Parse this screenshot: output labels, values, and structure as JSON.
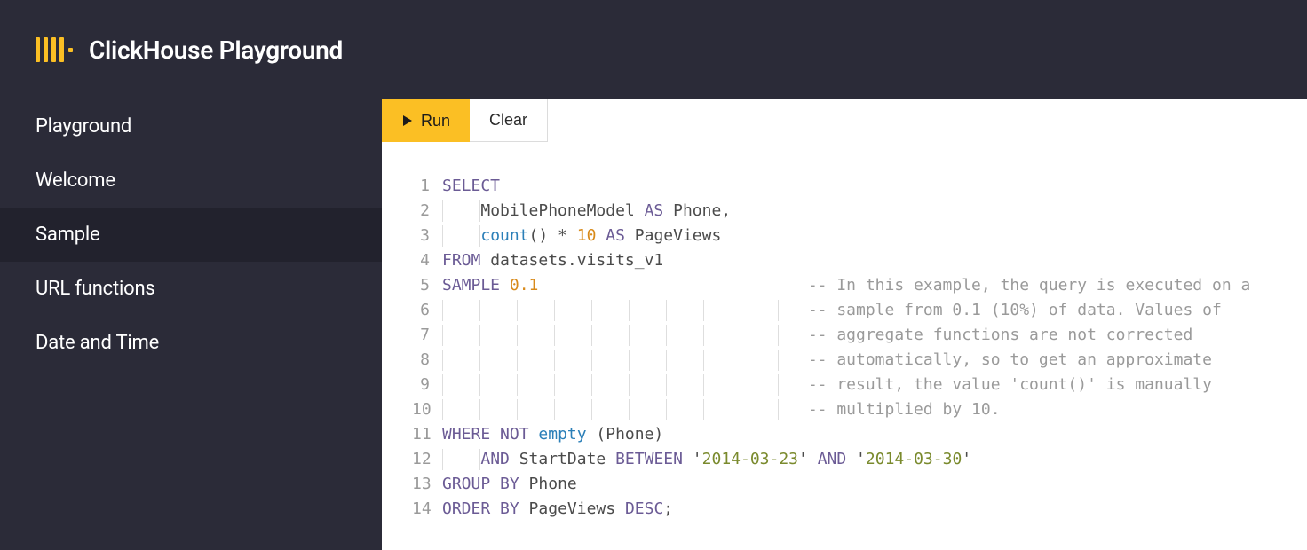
{
  "header": {
    "title": "ClickHouse Playground"
  },
  "sidebar": {
    "items": [
      {
        "label": "Playground",
        "active": false
      },
      {
        "label": "Welcome",
        "active": false
      },
      {
        "label": "Sample",
        "active": true
      },
      {
        "label": "URL functions",
        "active": false
      },
      {
        "label": "Date and Time",
        "active": false
      }
    ]
  },
  "toolbar": {
    "run": "Run",
    "clear": "Clear"
  },
  "editor": {
    "lines": [
      {
        "n": 1,
        "html": "<span class='kw'>SELECT</span>"
      },
      {
        "n": 2,
        "html": "<span class='guides short'>    </span><span class='ident'>MobilePhoneModel </span><span class='kw'>AS</span><span class='ident'> Phone,</span>"
      },
      {
        "n": 3,
        "html": "<span class='guides short'>    </span><span class='fn'>count</span><span class='ident'>() * </span><span class='num'>10</span><span class='ident'> </span><span class='kw'>AS</span><span class='ident'> PageViews</span>"
      },
      {
        "n": 4,
        "html": "<span class='kw'>FROM</span><span class='ident'> datasets.visits_v1</span>"
      },
      {
        "n": 5,
        "html": "<span class='kw'>SAMPLE</span><span class='ident'> </span><span class='num'>0.1</span><span class='ident'>                            </span><span class='cmt'>-- In this example, the query is executed on a</span>"
      },
      {
        "n": 6,
        "html": "<span class='guides'>                                      </span><span class='cmt'>-- sample from 0.1 (10%) of data. Values of</span>"
      },
      {
        "n": 7,
        "html": "<span class='guides'>                                      </span><span class='cmt'>-- aggregate functions are not corrected</span>"
      },
      {
        "n": 8,
        "html": "<span class='guides'>                                      </span><span class='cmt'>-- automatically, so to get an approximate</span>"
      },
      {
        "n": 9,
        "html": "<span class='guides'>                                      </span><span class='cmt'>-- result, the value 'count()' is manually</span>"
      },
      {
        "n": 10,
        "html": "<span class='guides'>                                      </span><span class='cmt'>-- multiplied by 10.</span>"
      },
      {
        "n": 11,
        "html": "<span class='kw'>WHERE</span><span class='ident'> </span><span class='kw'>NOT</span><span class='ident'> </span><span class='fn'>empty</span><span class='ident'> (Phone)</span>"
      },
      {
        "n": 12,
        "html": "<span class='guides short'>    </span><span class='kw'>AND</span><span class='ident'> StartDate </span><span class='kw'>BETWEEN</span><span class='ident'> '</span><span class='str'>2014-03-23</span><span class='ident'>' </span><span class='kw'>AND</span><span class='ident'> '</span><span class='str'>2014-03-30</span><span class='ident'>'</span>"
      },
      {
        "n": 13,
        "html": "<span class='kw'>GROUP</span><span class='ident'> </span><span class='kw'>BY</span><span class='ident'> Phone</span>"
      },
      {
        "n": 14,
        "html": "<span class='kw'>ORDER</span><span class='ident'> </span><span class='kw'>BY</span><span class='ident'> PageViews </span><span class='kw'>DESC</span><span class='ident'>;</span>"
      }
    ]
  }
}
